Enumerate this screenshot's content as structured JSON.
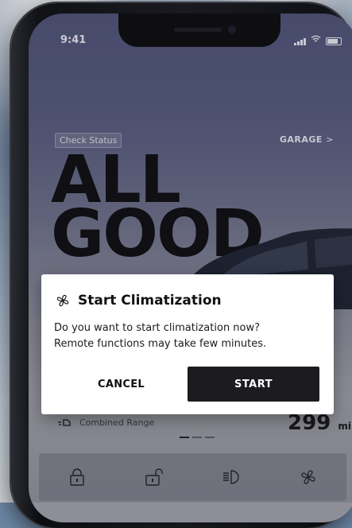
{
  "status_bar": {
    "time": "9:41"
  },
  "header": {
    "check_status": "Check Status",
    "garage": "GARAGE",
    "garage_chevron": ">"
  },
  "hero": {
    "line1": "ALL",
    "line2": "GOOD"
  },
  "range": {
    "label": "Combined Range",
    "value": "299",
    "unit": "mi"
  },
  "dialog": {
    "title": "Start Climatization",
    "message_line1": "Do you want to start climatization now?",
    "message_line2": "Remote functions may take few minutes.",
    "cancel_label": "CANCEL",
    "start_label": "START"
  },
  "quick_actions": [
    {
      "icon": "lock-icon"
    },
    {
      "icon": "unlock-icon"
    },
    {
      "icon": "headlights-icon"
    },
    {
      "icon": "fan-icon"
    }
  ],
  "pager": {
    "count": 3,
    "active": 0
  }
}
